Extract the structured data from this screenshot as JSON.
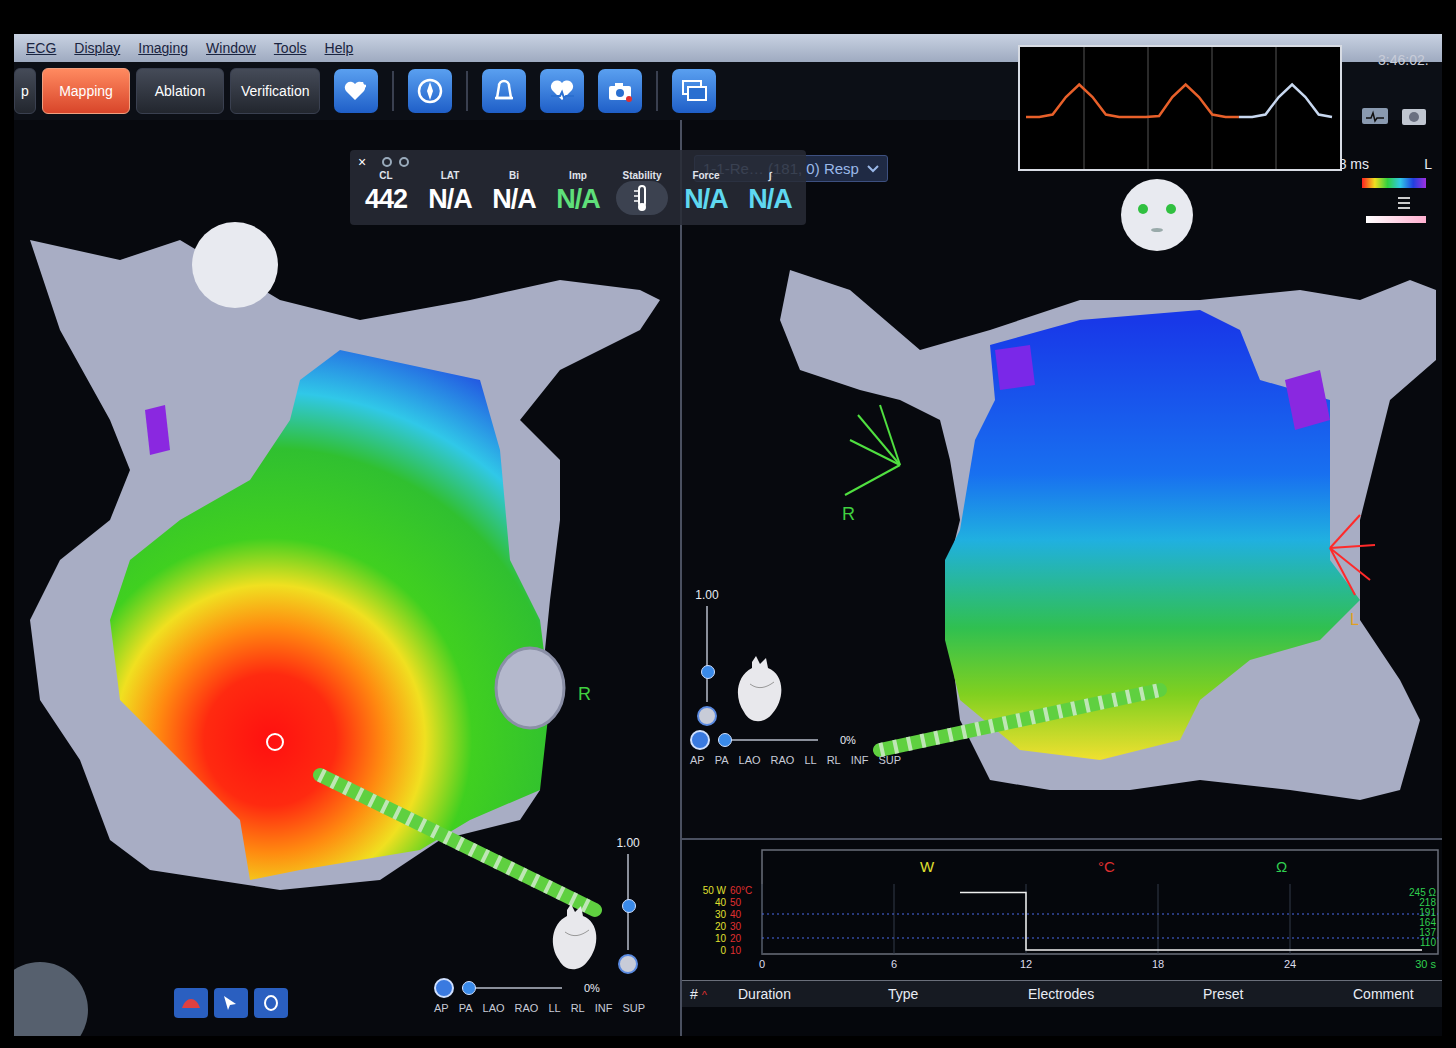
{
  "menu": [
    "ECG",
    "Display",
    "Imaging",
    "Window",
    "Tools",
    "Help"
  ],
  "modes": [
    {
      "label": "p",
      "selected": false
    },
    {
      "label": "Mapping",
      "selected": true
    },
    {
      "label": "Ablation",
      "selected": false
    },
    {
      "label": "Verification",
      "selected": false
    }
  ],
  "clock": "3:46:02.",
  "ecg": {
    "values": [
      0.2,
      0.2,
      0.25,
      0.6,
      0.85,
      0.6,
      0.25,
      0.2,
      0.2,
      0.2,
      0.22,
      0.6,
      0.85,
      0.6,
      0.25,
      0.2,
      0.2,
      0.2,
      0.25,
      0.6,
      0.85,
      0.6,
      0.25,
      0.2
    ]
  },
  "readout_close": "×",
  "readouts": [
    {
      "label": "CL",
      "value": "442",
      "kind": "value",
      "color": "#ffffff"
    },
    {
      "label": "LAT",
      "value": "N/A",
      "kind": "value",
      "color": "#ffffff"
    },
    {
      "label": "Bi",
      "value": "N/A",
      "kind": "value",
      "color": "#ffffff"
    },
    {
      "label": "Imp",
      "value": "N/A",
      "kind": "value",
      "color": "#5fe07a"
    },
    {
      "label": "Stability",
      "value": "",
      "kind": "icon",
      "color": "#ffffff"
    },
    {
      "label": "Force",
      "value": "N/A",
      "kind": "value",
      "color": "#5fd8f0"
    },
    {
      "label": "∫",
      "value": "N/A",
      "kind": "value",
      "color": "#5fd8f0"
    }
  ],
  "map_selector": {
    "label": "1-1-Re… (181, 0) Resp"
  },
  "scale": {
    "min": "-8 ms",
    "end": "L"
  },
  "left_view": {
    "orientation": "R",
    "zoom": "1.00",
    "zoom_level": 0.45,
    "opacity": "0%",
    "opacity_level": 0,
    "views": [
      "AP",
      "PA",
      "LAO",
      "RAO",
      "LL",
      "RL",
      "INF",
      "SUP"
    ]
  },
  "right_view": {
    "orientation": "R",
    "secondary": "L",
    "zoom": "1.00",
    "zoom_level": 0.3,
    "opacity": "0%",
    "opacity_level": 0,
    "views": [
      "AP",
      "PA",
      "LAO",
      "RAO",
      "LL",
      "RL",
      "INF",
      "SUP"
    ]
  },
  "ablation": {
    "headers": [
      {
        "label": "W",
        "color": "#e0e030"
      },
      {
        "label": "°C",
        "color": "#e03030"
      },
      {
        "label": "Ω",
        "color": "#30d050"
      }
    ],
    "power_ticks": [
      "50 W",
      "40",
      "30",
      "20",
      "10",
      "0"
    ],
    "temp_ticks": [
      "60°C",
      "50",
      "40",
      "30",
      "20",
      "10"
    ],
    "time_ticks": [
      "0",
      "6",
      "12",
      "18",
      "24"
    ],
    "impedance_ticks": [
      "245 Ω",
      "218",
      "191",
      "164",
      "137",
      "110"
    ],
    "end_label": "30 s",
    "power_trace": {
      "t": [
        9,
        12,
        12,
        30
      ],
      "w": [
        48,
        48,
        0,
        0
      ]
    }
  },
  "table": {
    "columns": [
      "#",
      "Duration",
      "Type",
      "Electrodes",
      "Preset",
      "Comment"
    ],
    "sort_icon": "^"
  }
}
